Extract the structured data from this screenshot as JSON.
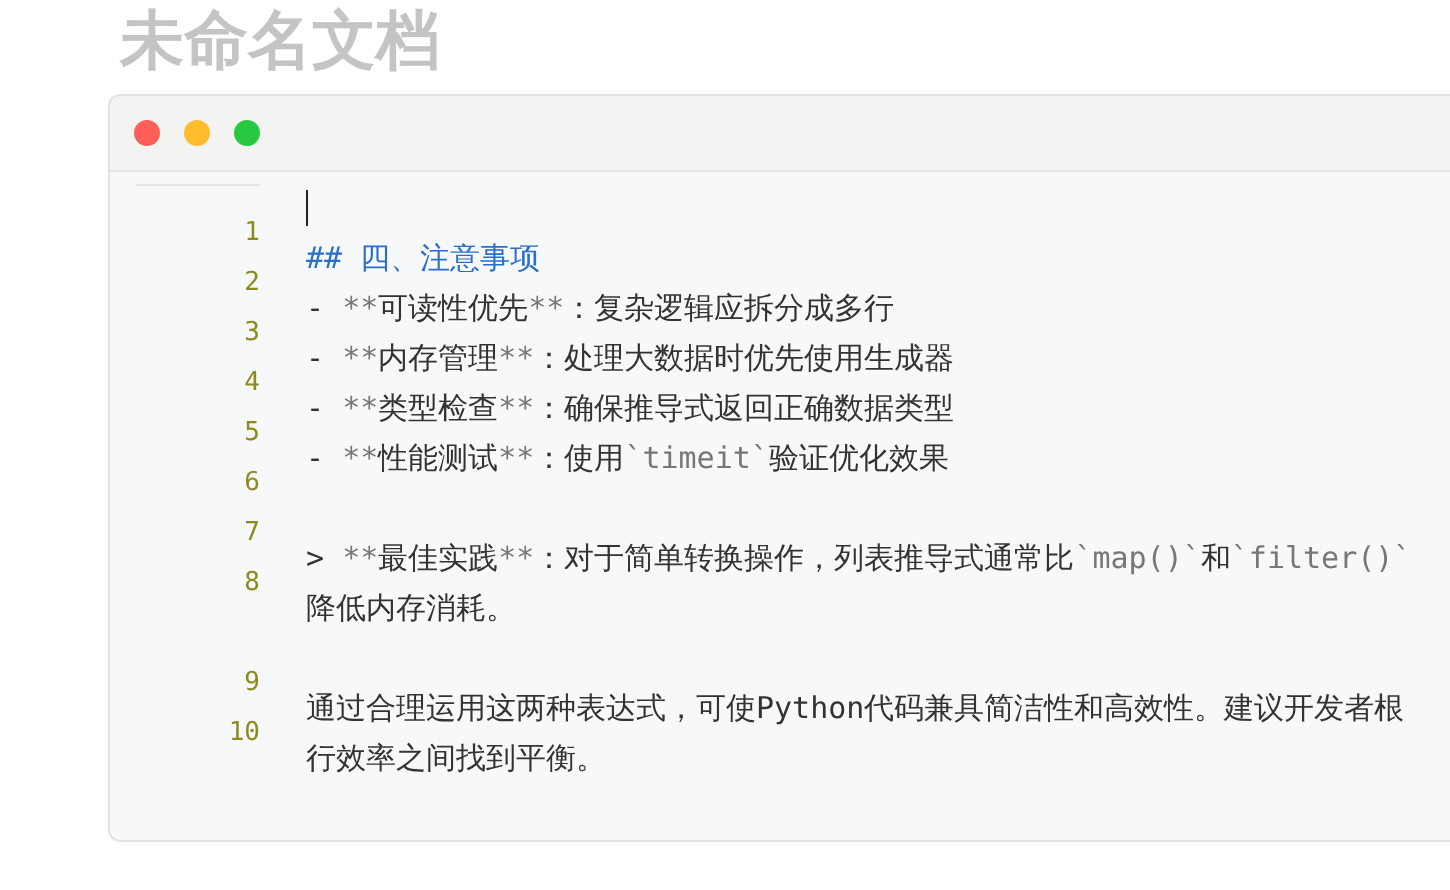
{
  "page_title": "未命名文档",
  "editor": {
    "window_controls": [
      {
        "color": "#ff5f57"
      },
      {
        "color": "#febc2e"
      },
      {
        "color": "#28c840"
      }
    ],
    "lines": [
      {
        "number": "1",
        "cursor": true
      },
      {
        "number": "2",
        "kind": "heading",
        "cursor": false,
        "rows": [
          "## 四、注意事项"
        ]
      },
      {
        "number": "3",
        "kind": "text",
        "cursor": false,
        "rows": [
          "- **可读性优先**：复杂逻辑应拆分成多行"
        ]
      },
      {
        "number": "4",
        "kind": "text",
        "cursor": false,
        "rows": [
          "- **内存管理**：处理大数据时优先使用生成器"
        ]
      },
      {
        "number": "5",
        "kind": "text",
        "cursor": false,
        "rows": [
          "- **类型检查**：确保推导式返回正确数据类型"
        ]
      },
      {
        "number": "6",
        "kind": "text",
        "cursor": false,
        "rows": [
          "- **性能测试**：使用`timeit`验证优化效果"
        ]
      },
      {
        "number": "7",
        "cursor": false
      },
      {
        "number": "8",
        "kind": "text",
        "cursor": false,
        "rows": [
          "> **最佳实践**：对于简单转换操作，列表推导式通常比`map()`和`filter()`",
          "降低内存消耗。"
        ]
      },
      {
        "number": "9",
        "cursor": false
      },
      {
        "number": "10",
        "kind": "text",
        "cursor": false,
        "rows": [
          "通过合理运用这两种表达式，可使Python代码兼具简洁性和高效性。建议开发者根",
          "行效率之间找到平衡。"
        ]
      }
    ]
  }
}
